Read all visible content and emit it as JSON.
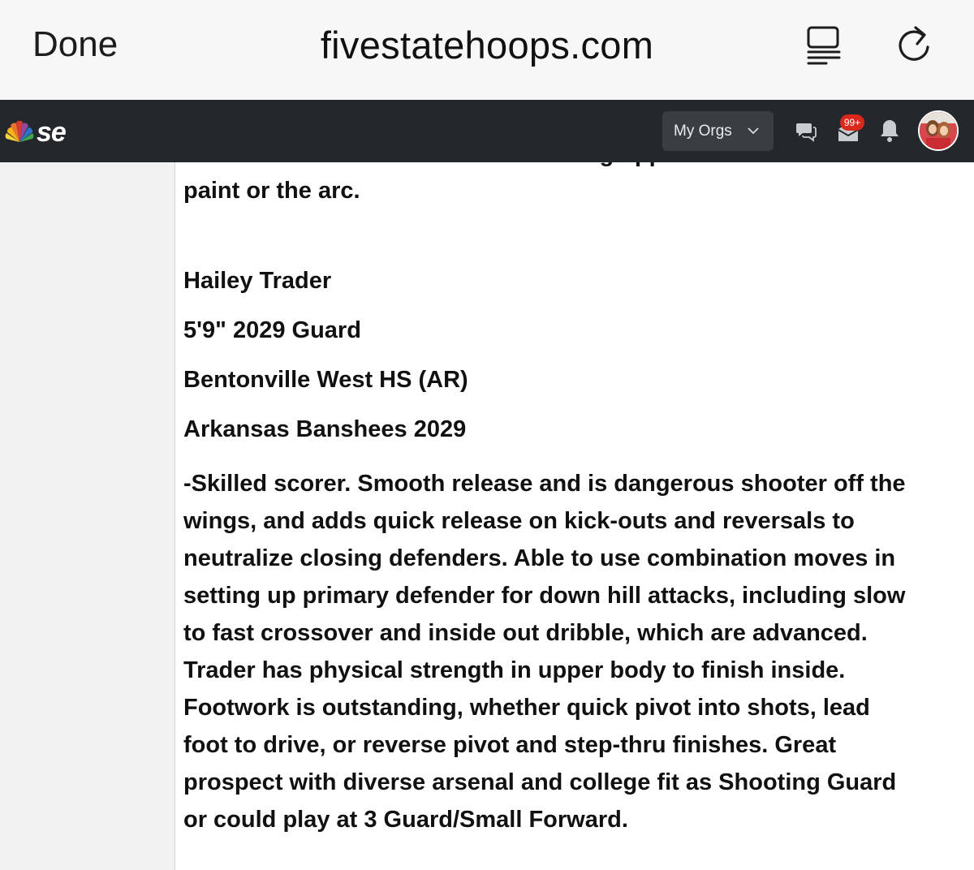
{
  "browser": {
    "done_label": "Done",
    "url": "fivestatehoops.com",
    "reader_icon": "reader-view-icon",
    "reload_icon": "reload-icon"
  },
  "nav": {
    "logo_text": "se",
    "logo_icon": "peacock-logo-icon",
    "orgs_label": "My Orgs",
    "messages_badge": "99+",
    "colors": {
      "nav_bg": "#24282c",
      "orgs_bg": "#393e43",
      "badge": "#d9291c"
    }
  },
  "article": {
    "cut_line": "four candidate who can create scoring opportunities from the",
    "lead_end": "paint or the arc.",
    "player": {
      "name": "Hailey Trader",
      "measurables": "5'9\" 2029 Guard",
      "school": "Bentonville West HS (AR)",
      "team": "Arkansas Banshees 2029"
    },
    "description_lines": [
      "-Skilled scorer. Smooth release and is dangerous shooter off the",
      "wings, and adds quick release on kick-outs and reversals to",
      "neutralize closing defenders. Able to use combination moves in",
      "setting up primary defender for down hill attacks, including slow",
      "to fast crossover and inside out dribble, which are advanced.",
      "Trader has physical strength in upper body to finish inside.",
      "Footwork is outstanding, whether quick pivot into shots, lead",
      "foot to drive, or reverse pivot and step-thru finishes. Great",
      "prospect with diverse arsenal and college fit as Shooting Guard",
      "or could play at 3 Guard/Small Forward."
    ]
  }
}
